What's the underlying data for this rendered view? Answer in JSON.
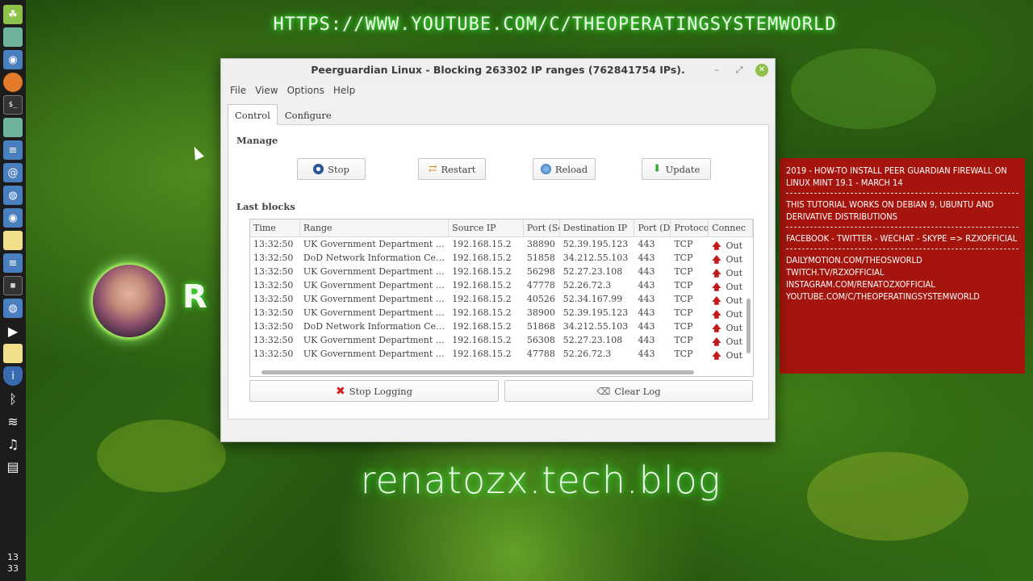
{
  "banner": {
    "url": "HTTPS://WWW.YOUTUBE.COM/C/THEOPERATINGSYSTEMWORLD",
    "blog": "renatozx.tech.blog",
    "webcam_letter": "R"
  },
  "info_panel": {
    "lines": [
      "2019 - How-to Install Peer Guardian Firewall on Linux Mint 19.1 - March 14",
      "This tutorial works on Debian 9, Ubuntu and derivative distributions",
      "Facebook - Twitter - WeChat - Skype => RZXOfficial",
      "Dailymotion.com/theosworld",
      "Twitch.tv/rzxofficial",
      "Instagram.com/renatozxofficial",
      "YouTube.com/c/theoperatingsystemworld"
    ]
  },
  "taskbar": {
    "clock_hour": "13",
    "clock_min": "33"
  },
  "window": {
    "title": "Peerguardian Linux -  Blocking 263302 IP ranges (762841754 IPs).",
    "min": "–",
    "max": "⤢",
    "close": "✕",
    "menu": [
      "File",
      "View",
      "Options",
      "Help"
    ],
    "tabs": [
      "Control",
      "Configure"
    ],
    "manage_label": "Manage",
    "last_blocks_label": "Last blocks",
    "buttons": {
      "stop": "Stop",
      "restart": "Restart",
      "reload": "Reload",
      "update": "Update",
      "stop_logging": "Stop Logging",
      "clear_log": "Clear Log"
    },
    "columns": [
      "Time",
      "Range",
      "Source IP",
      "Port (Sc",
      "Destination IP",
      "Port (D",
      "Protoco",
      "Connec"
    ],
    "rows": [
      [
        "13:32:50",
        "UK Government Department for...",
        "192.168.15.2",
        "38890",
        "52.39.195.123",
        "443",
        "TCP",
        "Out"
      ],
      [
        "13:32:50",
        "DoD Network Information Cent...",
        "192.168.15.2",
        "51858",
        "34.212.55.103",
        "443",
        "TCP",
        "Out"
      ],
      [
        "13:32:50",
        "UK Government Department for...",
        "192.168.15.2",
        "56298",
        "52.27.23.108",
        "443",
        "TCP",
        "Out"
      ],
      [
        "13:32:50",
        "UK Government Department for...",
        "192.168.15.2",
        "47778",
        "52.26.72.3",
        "443",
        "TCP",
        "Out"
      ],
      [
        "13:32:50",
        "UK Government Department for...",
        "192.168.15.2",
        "40526",
        "52.34.167.99",
        "443",
        "TCP",
        "Out"
      ],
      [
        "13:32:50",
        "UK Government Department for...",
        "192.168.15.2",
        "38900",
        "52.39.195.123",
        "443",
        "TCP",
        "Out"
      ],
      [
        "13:32:50",
        "DoD Network Information Cent...",
        "192.168.15.2",
        "51868",
        "34.212.55.103",
        "443",
        "TCP",
        "Out"
      ],
      [
        "13:32:50",
        "UK Government Department for...",
        "192.168.15.2",
        "56308",
        "52.27.23.108",
        "443",
        "TCP",
        "Out"
      ],
      [
        "13:32:50",
        "UK Government Department for...",
        "192.168.15.2",
        "47788",
        "52.26.72.3",
        "443",
        "TCP",
        "Out"
      ]
    ]
  },
  "colors": {
    "info_panel_bg": "#a5150e",
    "accent_green": "#8cc04a"
  }
}
